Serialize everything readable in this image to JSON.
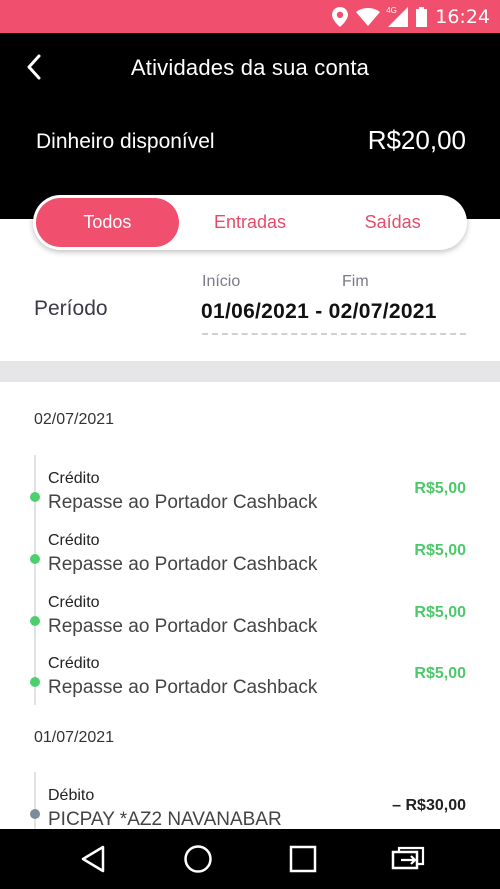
{
  "status_bar": {
    "time": "16:24",
    "network": "4G"
  },
  "header": {
    "title": "Atividades da sua conta",
    "balance_label": "Dinheiro disponível",
    "balance_value": "R$20,00"
  },
  "tabs": [
    {
      "label": "Todos",
      "active": true
    },
    {
      "label": "Entradas",
      "active": false
    },
    {
      "label": "Saídas",
      "active": false
    }
  ],
  "period": {
    "label": "Período",
    "start_label": "Início",
    "end_label": "Fim",
    "dates": "01/06/2021 - 02/07/2021"
  },
  "groups": [
    {
      "date": "02/07/2021",
      "entries": [
        {
          "type": "Crédito",
          "description": "Repasse ao Portador Cashback",
          "amount": "R$5,00"
        },
        {
          "type": "Crédito",
          "description": "Repasse ao Portador Cashback",
          "amount": "R$5,00"
        },
        {
          "type": "Crédito",
          "description": "Repasse ao Portador Cashback",
          "amount": "R$5,00"
        },
        {
          "type": "Crédito",
          "description": "Repasse ao Portador Cashback",
          "amount": "R$5,00"
        }
      ]
    },
    {
      "date": "01/07/2021",
      "entries": [
        {
          "type": "Débito",
          "description": "PICPAY *AZ2 NAVANABAR",
          "amount": "– R$30,00"
        }
      ]
    }
  ],
  "colors": {
    "accent": "#f0506e",
    "credit": "#4cc96a",
    "credit_dot": "#4cd06e",
    "debit_dot": "#7d8a9a",
    "debit_amount": "#222222"
  },
  "icons": {
    "back": "chevron-left-icon",
    "nav_back": "triangle-back-icon",
    "nav_home": "circle-home-icon",
    "nav_recents": "square-recents-icon",
    "nav_cast": "screen-rotate-icon"
  }
}
